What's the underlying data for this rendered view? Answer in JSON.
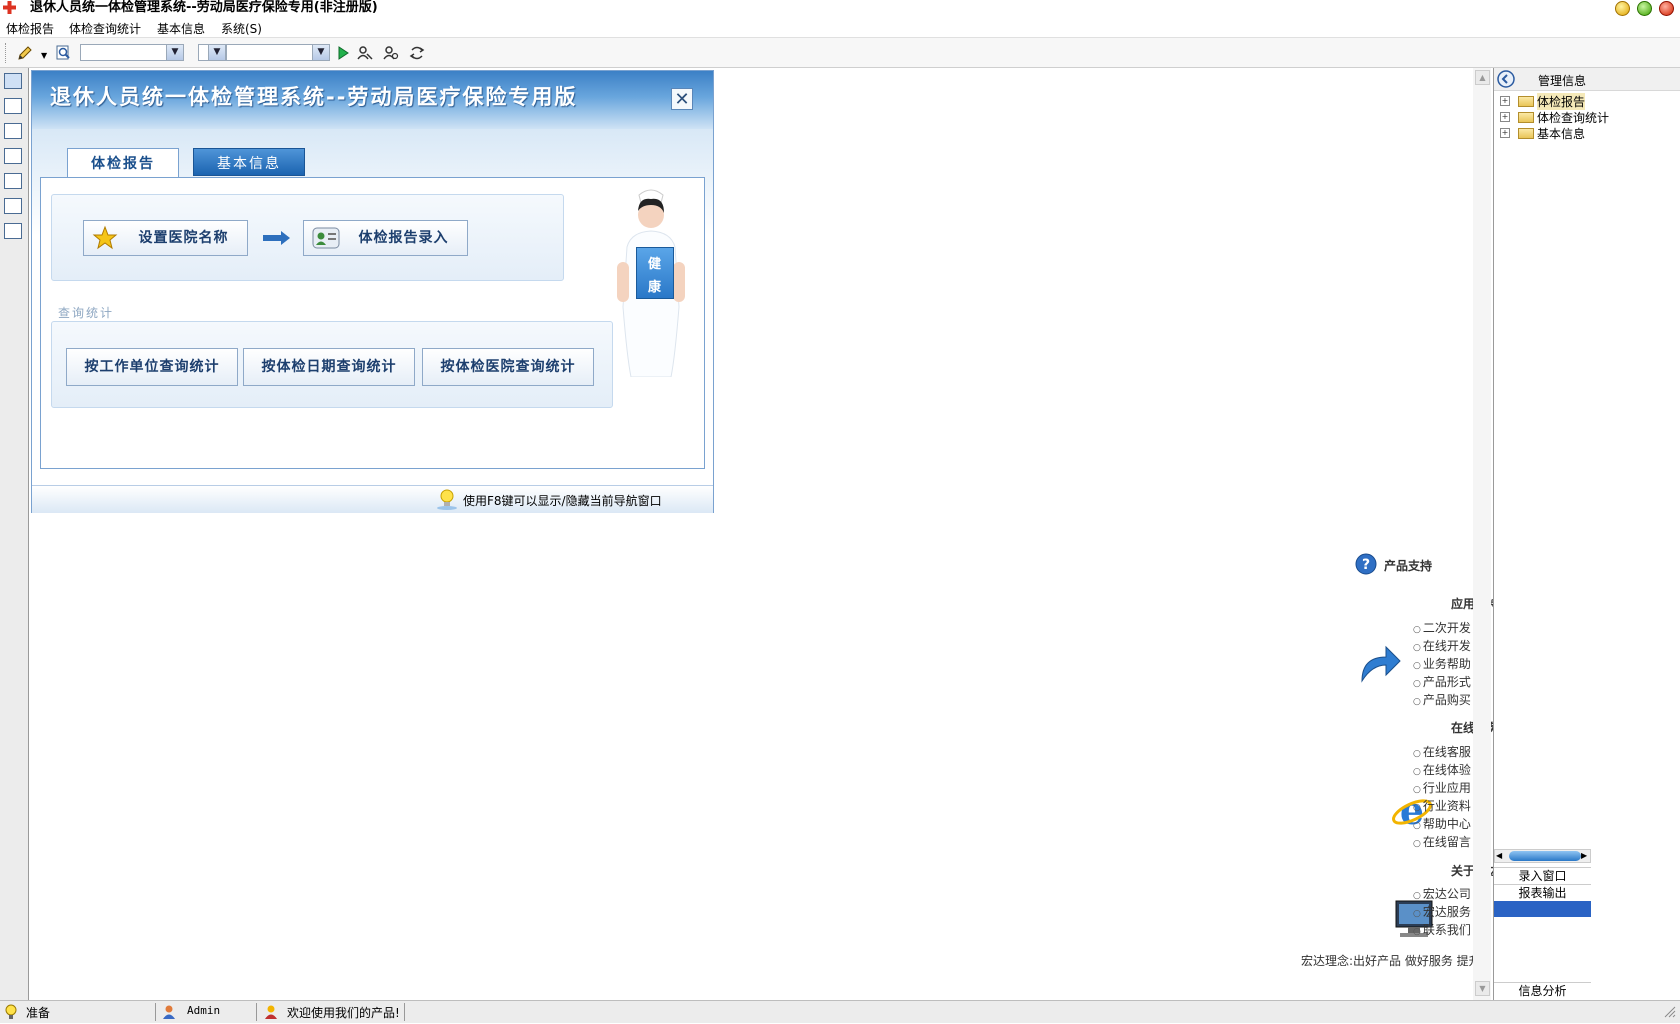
{
  "window": {
    "title": "退休人员统一体检管理系统--劳动局医疗保险专用(非注册版)"
  },
  "menu": [
    "体检报告",
    "体检查询统计",
    "基本信息",
    "系统(S)"
  ],
  "toolbar": {
    "combo1": "",
    "combo2": "",
    "icons": [
      "pencil-icon",
      "search-icon",
      "play-icon",
      "find-user-icon",
      "search-user-icon",
      "refresh-icon"
    ]
  },
  "nav_window": {
    "title": "退休人员统一体检管理系统--劳动局医疗保险专用版",
    "tabs": [
      "体检报告",
      "基本信息"
    ],
    "workflow_buttons": [
      "设置医院名称",
      "体检报告录入"
    ],
    "query_group_label": "查询统计",
    "query_buttons": [
      "按工作单位查询统计",
      "按体检日期查询统计",
      "按体检医院查询统计"
    ],
    "nurse_card": [
      "健",
      "康"
    ],
    "footer_hint": "使用F8键可以显示/隐藏当前导航窗口"
  },
  "support": {
    "title": "产品支持",
    "sections": [
      {
        "heading": "应用支持",
        "items": [
          "二次开发",
          "在线开发",
          "业务帮助",
          "产品形式",
          "产品购买"
        ]
      },
      {
        "heading": "在线服务",
        "items": [
          "在线客服",
          "在线体验",
          "行业应用",
          "行业资料",
          "帮助中心",
          "在线留言"
        ]
      },
      {
        "heading": "关于宏达",
        "items": [
          "宏达公司",
          "宏达服务",
          "联系我们"
        ]
      }
    ],
    "motto": "宏达理念:出好产品 做好服务 提升客户价值!"
  },
  "right_panel": {
    "header": "管理信息",
    "tree": [
      "体检报告",
      "体检查询统计",
      "基本信息"
    ],
    "bottom_tabs": [
      "录入窗口",
      "报表输出",
      "",
      "信息分析"
    ]
  },
  "statusbar": {
    "ready": "准备",
    "user": "Admin",
    "welcome": "欢迎使用我们的产品!"
  },
  "colors": {
    "accent": "#1b63b0",
    "header_blue": "#3c80c6"
  }
}
